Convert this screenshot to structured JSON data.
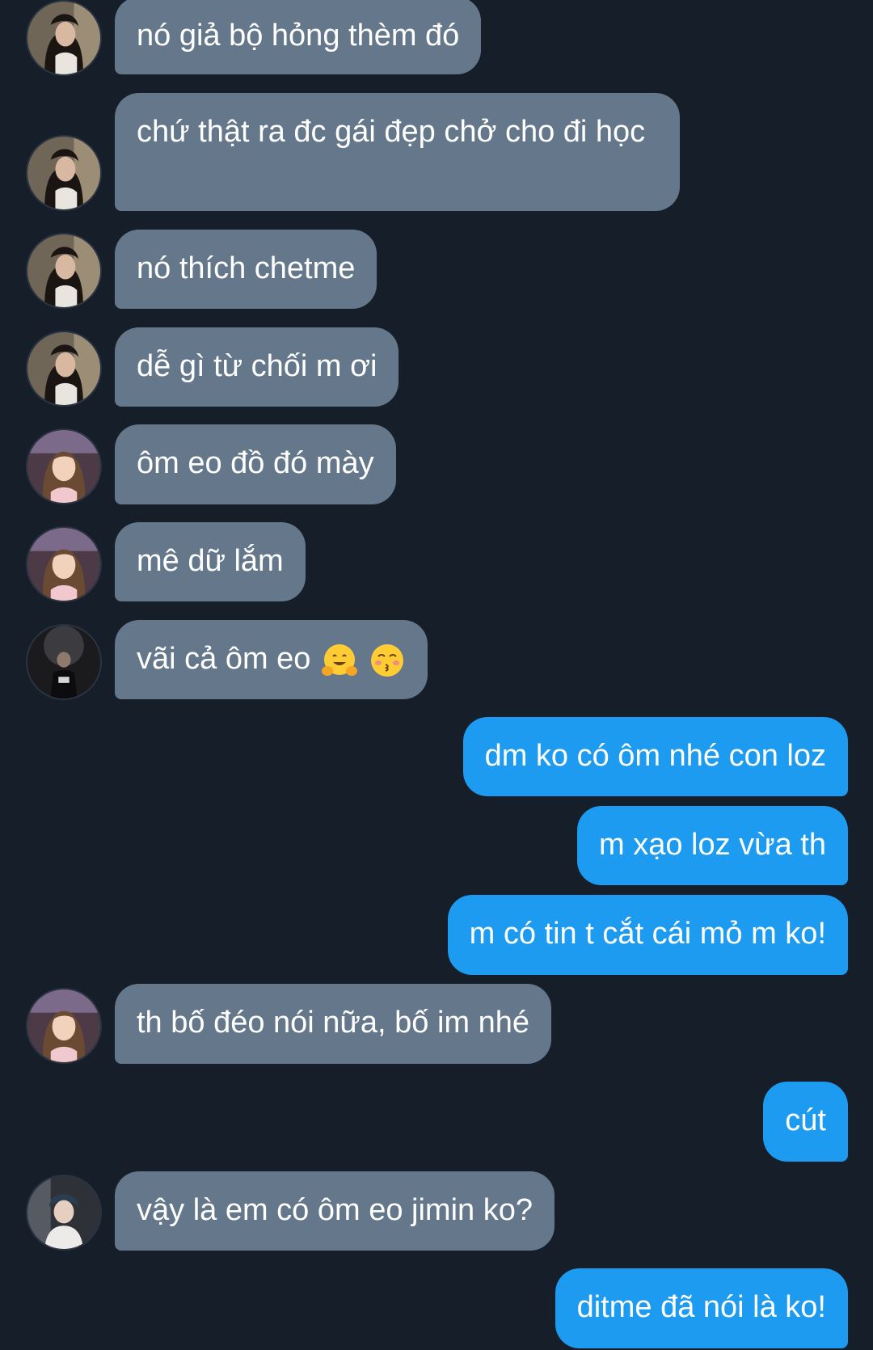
{
  "conversation": {
    "messages": [
      {
        "side": "in",
        "text": "nó giả bộ hỏng thèm đó"
      },
      {
        "side": "in",
        "text": "chứ thật ra đc gái đẹp chở cho đi học"
      },
      {
        "side": "in",
        "text": "nó thích chetme"
      },
      {
        "side": "in",
        "text": "dễ gì từ chối m ơi"
      },
      {
        "side": "in",
        "text": "ôm eo đồ đó mày"
      },
      {
        "side": "in",
        "text": "mê dữ lắm"
      },
      {
        "side": "in",
        "text": "vãi cả ôm eo",
        "emoji": [
          "hugging-face-emoji",
          "kissing-face-emoji"
        ]
      },
      {
        "side": "out",
        "text": "dm ko có ôm nhé con loz"
      },
      {
        "side": "out",
        "text": "m xạo loz vừa th"
      },
      {
        "side": "out",
        "text": "m có tin t cắt cái mỏ m ko!"
      },
      {
        "side": "in",
        "text": "th bố đéo nói nữa, bố im nhé"
      },
      {
        "side": "out",
        "text": "cút"
      },
      {
        "side": "in",
        "text": "vậy là em có ôm eo jimin ko?"
      },
      {
        "side": "out",
        "text": "ditme đã nói là ko!"
      }
    ]
  },
  "theme": {
    "background": "#161e29",
    "incoming_bubble": "#65778a",
    "outgoing_bubble": "#1d9bf0",
    "text": "#ffffff"
  }
}
